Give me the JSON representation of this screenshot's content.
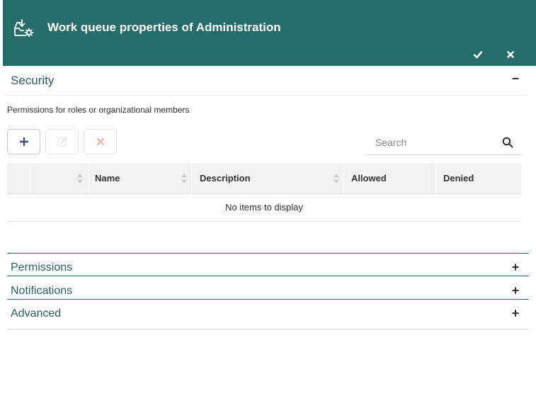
{
  "dialog": {
    "title": "Work queue properties of Administration",
    "header_icon": "inbox-gear-icon",
    "ok_icon": "check-icon",
    "close_icon": "close-icon"
  },
  "sections": {
    "security": {
      "title": "Security",
      "toggle_icon": "minus-icon"
    },
    "permissions": {
      "title": "Permissions",
      "toggle_icon": "plus-icon"
    },
    "notifications": {
      "title": "Notifications",
      "toggle_icon": "plus-icon"
    },
    "advanced": {
      "title": "Advanced",
      "toggle_icon": "plus-icon"
    }
  },
  "security_panel": {
    "caption": "Permissions for roles or organizational members",
    "toolbar": {
      "add_icon": "plus-icon",
      "edit_icon": "edit-icon",
      "delete_icon": "delete-icon"
    },
    "search": {
      "placeholder": "Search",
      "icon": "search-icon"
    },
    "grid": {
      "columns": [
        "",
        "Name",
        "Description",
        "Allowed",
        "Denied"
      ],
      "empty_message": "No items to display"
    }
  },
  "colors": {
    "header_bg": "#256d68",
    "section_title": "#2f5f5c",
    "add_icon": "#4a4d8c",
    "disabled_delete": "#f2b8b8"
  }
}
